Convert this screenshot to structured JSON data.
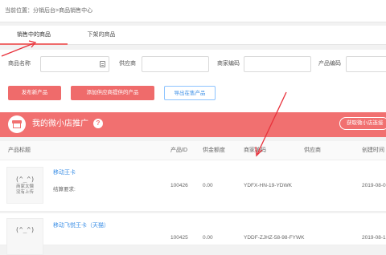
{
  "breadcrumb": {
    "text": "当前位置：分销后台>商品销售中心"
  },
  "tabs": [
    {
      "label": "销售中的商品"
    },
    {
      "label": "下架的商品"
    }
  ],
  "filters": {
    "name_label": "商品名称",
    "supplier_label": "供应商",
    "merchant_code_label": "商家编码",
    "product_code_label": "产品编码"
  },
  "actions": {
    "publish": "发布新产品",
    "add_supplier": "添加供应商提供的产品",
    "export": "导出在售产品"
  },
  "promo": {
    "title": "我的微小店推广",
    "help": "?",
    "get_button": "获取微小店连接"
  },
  "table": {
    "headers": [
      "产品标题",
      "产品ID",
      "供金额度",
      "商家编码",
      "供应商",
      "创建时间"
    ],
    "rows": [
      {
        "thumb_face": "(^_^)",
        "thumb_caption": "商家太懒\n没有上传",
        "title": "移动王卡",
        "note": "结算要求:",
        "id": "100426",
        "amount": "0.00",
        "code": "YDFX-HN-19-YDWK",
        "supplier": "",
        "created": "2019-08-0"
      },
      {
        "thumb_face": "(^_^)",
        "thumb_caption": "",
        "title": "移动飞悦王卡（天猫）",
        "note": "",
        "id": "100425",
        "amount": "0.00",
        "code": "YDDF-ZJHZ-58-98-FYWK",
        "supplier": "",
        "created": "2019-08-1"
      }
    ]
  },
  "colors": {
    "accent": "#f17070",
    "button_red": "#ef6b6b",
    "link": "#3a8ee6",
    "arrow": "#e8303a"
  }
}
